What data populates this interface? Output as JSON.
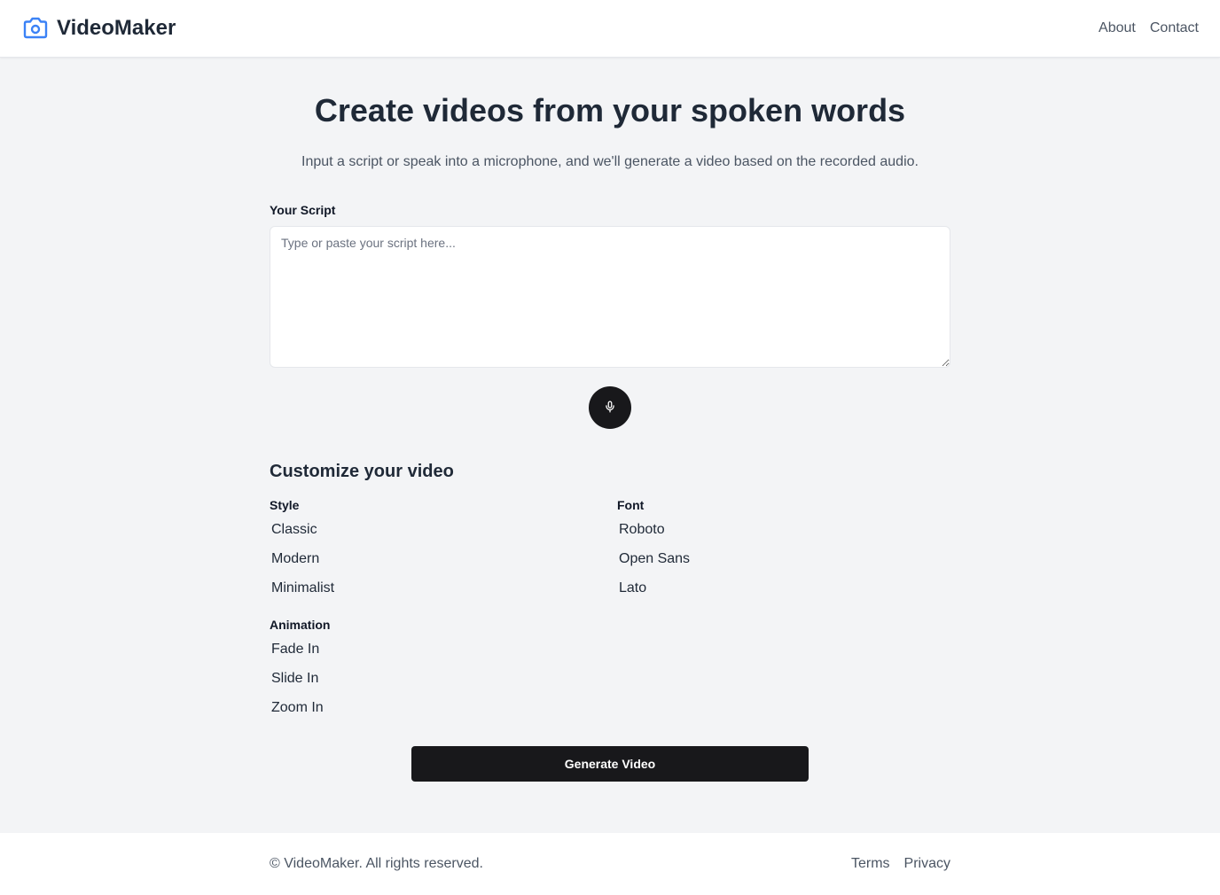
{
  "header": {
    "brand_name": "VideoMaker",
    "brand_icon": "camera-icon",
    "nav": [
      {
        "label": "About"
      },
      {
        "label": "Contact"
      }
    ]
  },
  "hero": {
    "title": "Create videos from your spoken words",
    "subtitle": "Input a script or speak into a microphone, and we'll generate a video based on the recorded audio."
  },
  "script": {
    "label": "Your Script",
    "placeholder": "Type or paste your script here...",
    "value": "",
    "mic_icon": "microphone-icon"
  },
  "customize": {
    "title": "Customize your video",
    "style": {
      "label": "Style",
      "options": [
        "Classic",
        "Modern",
        "Minimalist"
      ]
    },
    "font": {
      "label": "Font",
      "options": [
        "Roboto",
        "Open Sans",
        "Lato"
      ]
    },
    "animation": {
      "label": "Animation",
      "options": [
        "Fade In",
        "Slide In",
        "Zoom In"
      ]
    }
  },
  "actions": {
    "generate_label": "Generate Video"
  },
  "footer": {
    "copyright": "© VideoMaker. All rights reserved.",
    "links": [
      {
        "label": "Terms"
      },
      {
        "label": "Privacy"
      }
    ]
  },
  "colors": {
    "brand_icon": "#3b82f6",
    "button_dark": "#18181b",
    "page_bg": "#f3f4f6"
  }
}
